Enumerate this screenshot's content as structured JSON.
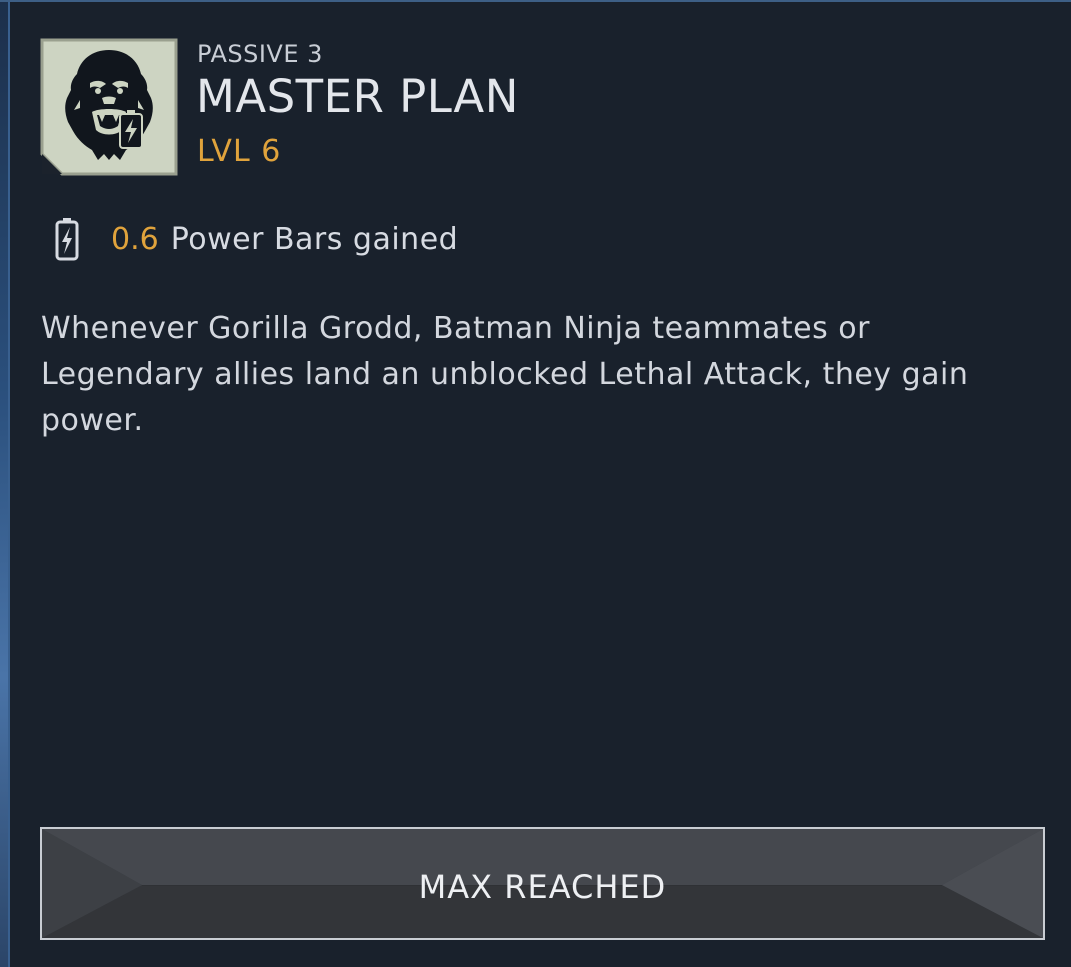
{
  "ability": {
    "kicker": "PASSIVE 3",
    "title": "MASTER PLAN",
    "level": "LVL 6",
    "portrait_icon": "gorilla-grodd-icon",
    "portrait_badge_icon": "power-battery-icon"
  },
  "stat": {
    "icon": "power-battery-icon",
    "value": "0.6",
    "label": "Power Bars gained"
  },
  "description": "Whenever Gorilla Grodd, Batman Ninja teammates or Legendary allies land an unblocked Lethal Attack, they gain power.",
  "button": {
    "label": "MAX REACHED"
  },
  "colors": {
    "background": "#19212c",
    "accent_gold": "#e0a33c",
    "text_primary": "#e3e6eb",
    "text_secondary": "#c9ced6",
    "button_fill": "#3b3e44",
    "button_border": "#c9cdd3",
    "portrait_fill": "#c9d0bd"
  }
}
